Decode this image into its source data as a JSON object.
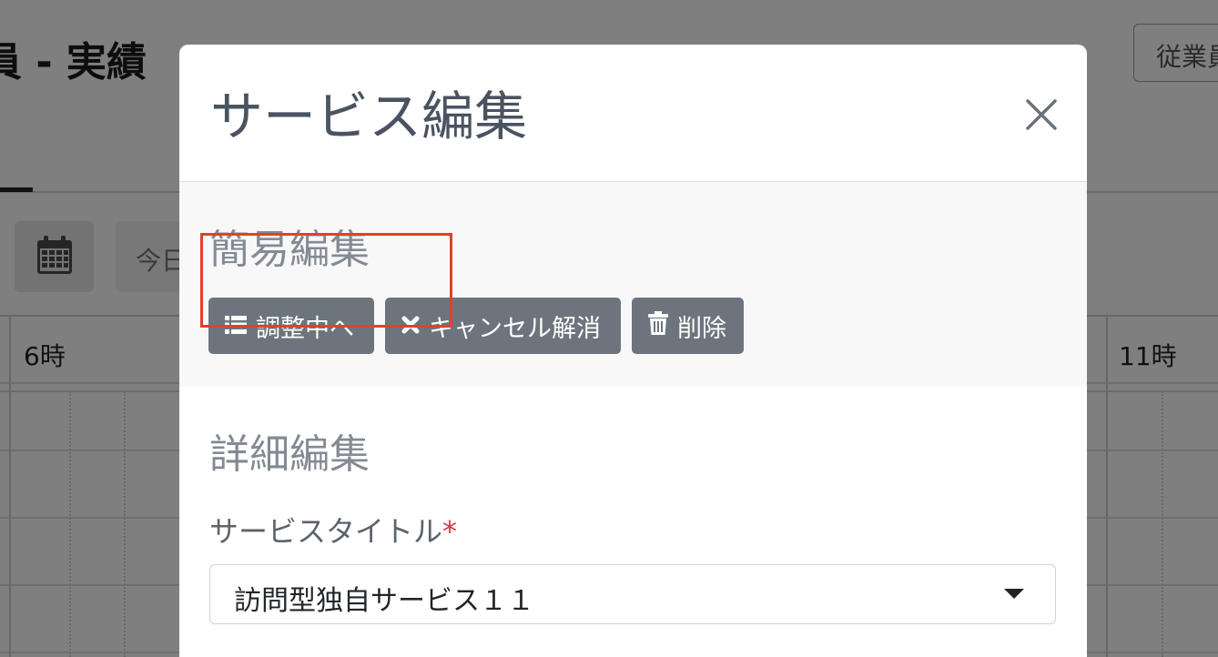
{
  "background": {
    "page_title": "員 - 実績",
    "employee_button": "従業員",
    "today_button": "今日",
    "hour_labels": [
      "6時",
      "11時"
    ]
  },
  "modal": {
    "title": "サービス編集",
    "quick_edit": {
      "heading": "簡易編集",
      "buttons": {
        "adjusting": "調整中へ",
        "cancel_release": "キャンセル解消",
        "delete": "削除"
      }
    },
    "detail_edit": {
      "heading": "詳細編集",
      "service_title_label": "サービスタイトル",
      "required_mark": "*",
      "service_title_value": "訪問型独自サービス１１"
    }
  },
  "colors": {
    "button": "#6c757d",
    "highlight": "#e2402c",
    "required": "#dc3545"
  },
  "icons": [
    "calendar-icon",
    "close-icon",
    "list-icon",
    "times-icon",
    "trash-icon",
    "caret-down-icon"
  ]
}
